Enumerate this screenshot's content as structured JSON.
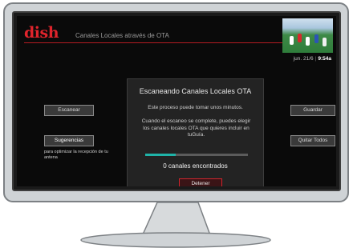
{
  "header": {
    "logo": "dish",
    "title": "Canales Locales através de OTA",
    "date": "jun. 21/6",
    "time": "9:54a"
  },
  "sidebar_left": {
    "scan_label": "Escanear",
    "suggestions_label": "Sugerencias",
    "suggestions_note": "para optimizar la recepción de tu antena"
  },
  "sidebar_right": {
    "save_label": "Guardar",
    "clear_all_label": "Quitar Todos"
  },
  "dialog": {
    "title": "Escaneando Canales Locales OTA",
    "message1": "Este proceso puede tomar unos minutos.",
    "message2": "Cuando el escaneo se complete, puedes elegir los canales locales OTA que quieres incluir en tuGuía.",
    "progress": 0.3,
    "channels_found": "0 canales encontrados",
    "stop_label": "Detener"
  },
  "colors": {
    "brand_red": "#e0242c",
    "progress": "#1fb3a8"
  },
  "icons": {
    "thumbnail": "live-tv-thumbnail"
  }
}
